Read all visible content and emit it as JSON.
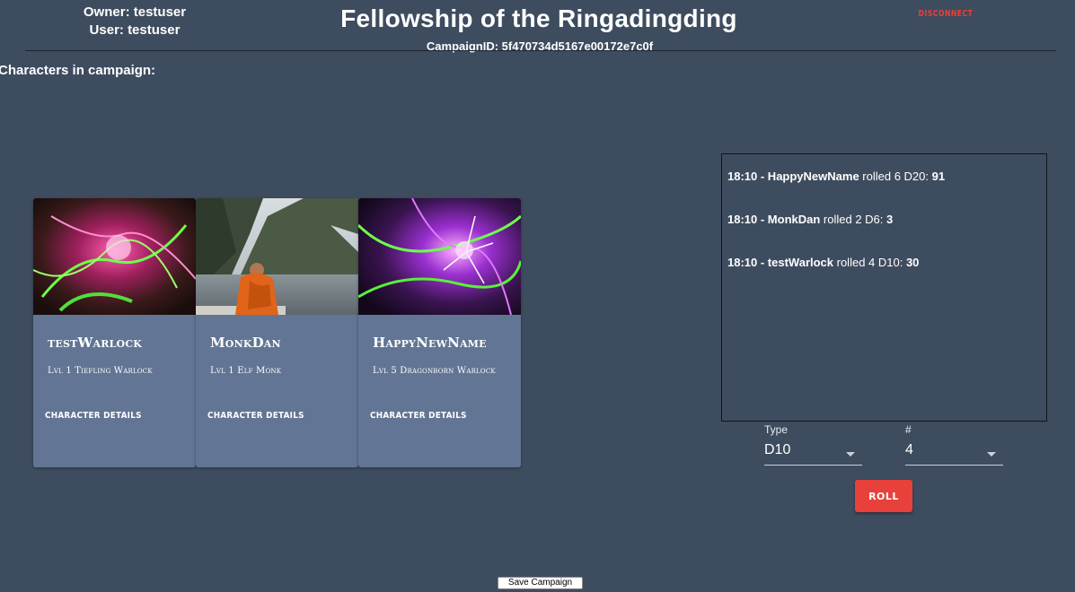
{
  "header": {
    "owner": "Owner: testuser",
    "user": "User: testuser",
    "title": "Fellowship of the Ringadingding",
    "campaign_id": "CampaignID: 5f470734d5167e00172e7c0f",
    "disconnect_label": "DISCONNECT"
  },
  "section_label": "Characters in campaign:",
  "cards": [
    {
      "name": "testWarlock",
      "subtitle": "Lvl 1 Tiefling Warlock",
      "button": "CHARACTER DETAILS",
      "image": "pink-green-energy-art"
    },
    {
      "name": "MonkDan",
      "subtitle": "Lvl 1 Elf Monk",
      "button": "CHARACTER DETAILS",
      "image": "monk-by-lake-photo"
    },
    {
      "name": "HappyNewName",
      "subtitle": "Lvl 5 Dragonborn Warlock",
      "button": "CHARACTER DETAILS",
      "image": "purple-green-energy-art"
    }
  ],
  "roll_log": [
    {
      "time_name": "18:10 - HappyNewName",
      "text": " rolled 6 D20: ",
      "result": "91"
    },
    {
      "time_name": "18:10 - MonkDan",
      "text": " rolled 2 D6: ",
      "result": "3"
    },
    {
      "time_name": "18:10 - testWarlock",
      "text": " rolled 4 D10: ",
      "result": "30"
    }
  ],
  "dice": {
    "type_label": "Type",
    "type_value": "D10",
    "count_label": "#",
    "count_value": "4",
    "roll_label": "ROLL"
  },
  "save_label": "Save Campaign",
  "colors": {
    "background": "#3e4c5f",
    "card": "#627594",
    "accent": "#e8403a"
  }
}
